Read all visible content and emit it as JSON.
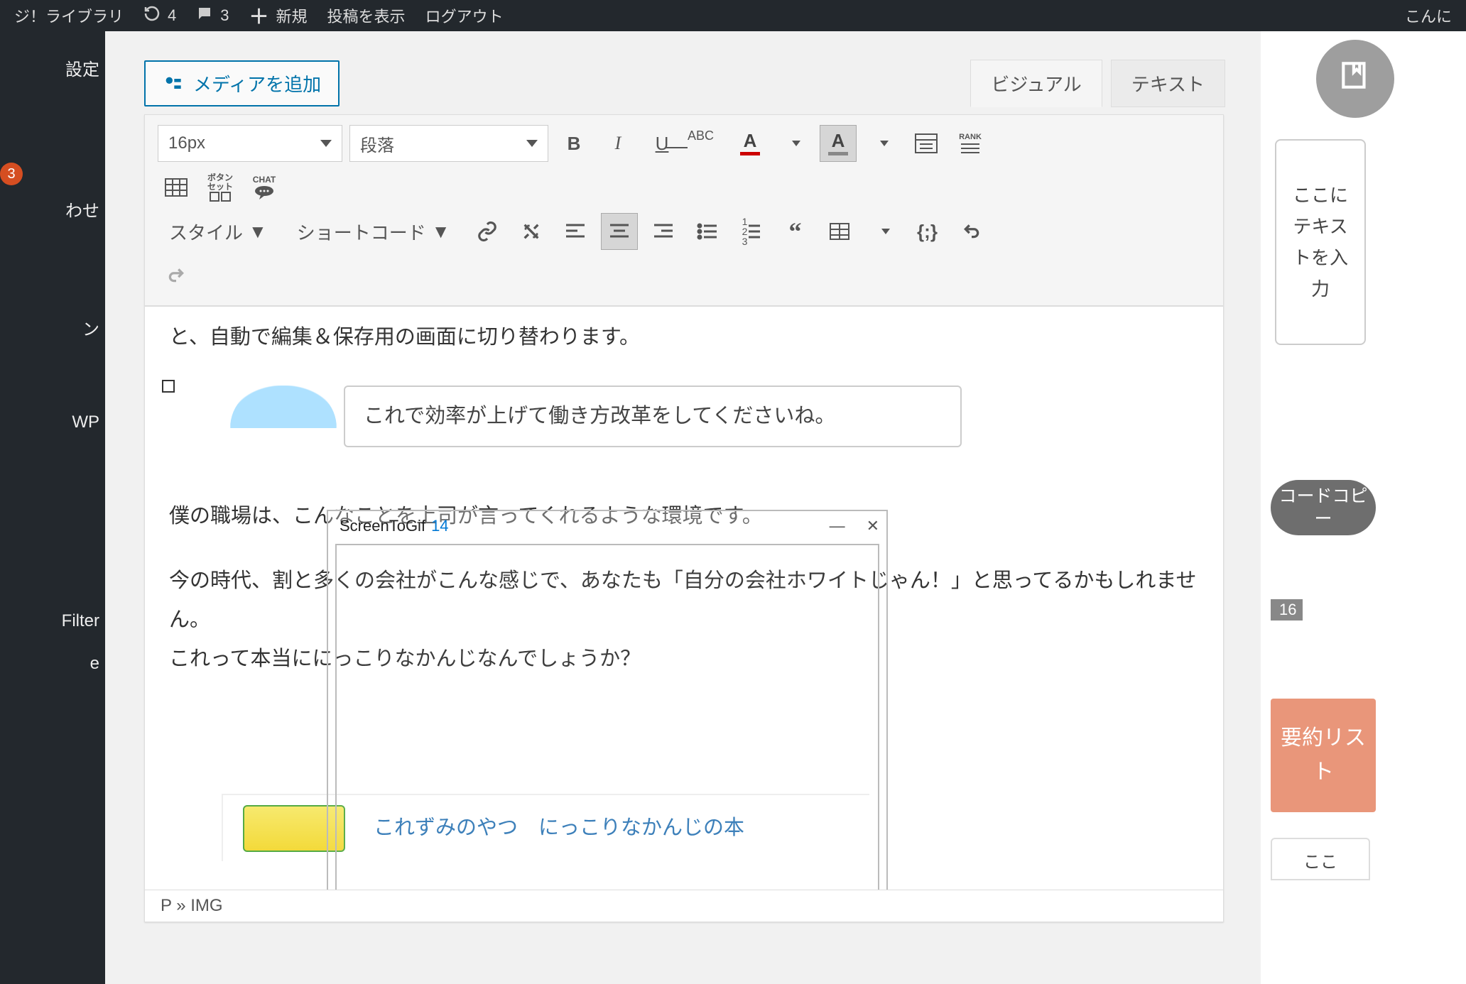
{
  "adminbar": {
    "site": "ジ！ライブラリ",
    "refresh_count": "4",
    "comments_count": "3",
    "new_label": "新規",
    "view_post": "投稿を表示",
    "logout": "ログアウト",
    "greeting": "こんに"
  },
  "leftnav": {
    "items": [
      {
        "label": "設定"
      },
      {
        "label": "",
        "badge": "3"
      },
      {
        "label": "わせ"
      },
      {
        "label": "ン"
      },
      {
        "label": "WP"
      },
      {
        "label": "Filter"
      },
      {
        "label": "e"
      }
    ]
  },
  "editor": {
    "add_media": "メディアを追加",
    "tabs": {
      "visual": "ビジュアル",
      "text": "テキスト"
    },
    "font_size": "16px",
    "paragraph": "段落",
    "style_label": "スタイル",
    "shortcode_label": "ショートコード",
    "button_set_label": "ボタン\nセット",
    "chat_label": "CHAT",
    "rank_label": "RANK"
  },
  "content": {
    "line1": "と、自動で編集＆保存用の画面に切り替わります。",
    "speech": "これで効率が上げて働き方改革をしてくださいね。",
    "body1": "僕の職場は、こんなことを上司が言ってくれるような環境です。",
    "body2": "今の時代、割と多くの会社がこんな感じで、あなたも「自分の会社ホワイトじゃん！」と思ってるかもしれません。",
    "body3": "これって本当ににっこりなかんじなんでしょうか？",
    "link_title": "これずみのやつ　にっこりなかんじの本"
  },
  "screentogif": {
    "title": "ScreenToGif",
    "count": "14"
  },
  "statusbar": {
    "path": "P » IMG"
  },
  "rightrail": {
    "placeholder": "ここにテキストを入力",
    "copy": "コードコピー",
    "tag": "16",
    "summary": "要約リスト",
    "here": "ここ"
  }
}
